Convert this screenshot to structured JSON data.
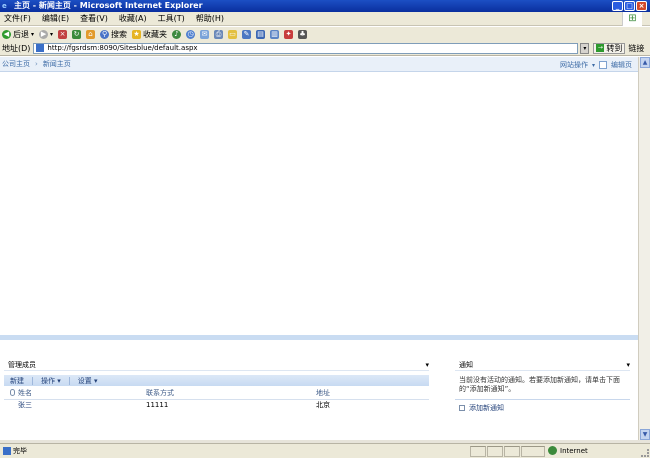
{
  "window": {
    "title": "主页 - 新闻主页 - Microsoft Internet Explorer",
    "minimize": "_",
    "maximize": "□",
    "close": "×"
  },
  "menubar": {
    "items": [
      "文件(F)",
      "编辑(E)",
      "查看(V)",
      "收藏(A)",
      "工具(T)",
      "帮助(H)"
    ]
  },
  "toolbar": {
    "back": "后退",
    "search": "搜索",
    "favorites": "收藏夹"
  },
  "address": {
    "label": "地址(D)",
    "url": "http://fgsrdsm:8090/Sitesblue/default.aspx",
    "go": "转到",
    "links": "链接"
  },
  "sharepoint": {
    "breadcrumb": [
      "公司主页",
      "新闻主页"
    ],
    "site_actions": "网站操作",
    "edit_page": "编辑页"
  },
  "members_panel": {
    "title": "管理成员",
    "menu_arrow": "▾",
    "toolbar": [
      "新建",
      "操作",
      "设置"
    ],
    "columns": [
      "姓名",
      "联系方式",
      "地址"
    ],
    "rows": [
      {
        "name": "张三",
        "contact": "11111",
        "address": "北京"
      }
    ]
  },
  "notices_panel": {
    "title": "通知",
    "menu_arrow": "▾",
    "body": "当前没有活动的通知。若要添加新通知，请单击下面的“添加新通知”。",
    "add_link": "添加新通知"
  },
  "statusbar": {
    "status": "完毕",
    "zone": "Internet"
  },
  "colors": {
    "titlebar": "#0a2f9e",
    "chrome": "#ece9d8",
    "sp_nav": "#e9f0f9",
    "link": "#24427a"
  }
}
